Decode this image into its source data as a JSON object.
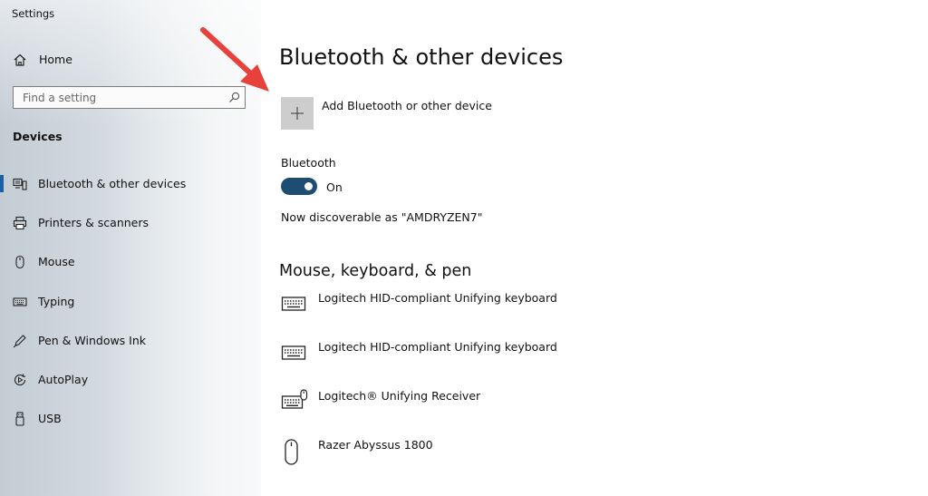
{
  "app_title": "Settings",
  "sidebar": {
    "home_label": "Home",
    "search_placeholder": "Find a setting",
    "section_label": "Devices",
    "items": [
      {
        "label": "Bluetooth & other devices",
        "icon": "bluetooth-devices-icon",
        "active": true
      },
      {
        "label": "Printers & scanners",
        "icon": "printer-icon"
      },
      {
        "label": "Mouse",
        "icon": "mouse-icon"
      },
      {
        "label": "Typing",
        "icon": "keyboard-icon"
      },
      {
        "label": "Pen & Windows Ink",
        "icon": "pen-icon"
      },
      {
        "label": "AutoPlay",
        "icon": "autoplay-icon"
      },
      {
        "label": "USB",
        "icon": "usb-icon"
      }
    ]
  },
  "main": {
    "title": "Bluetooth & other devices",
    "add_device_label": "Add Bluetooth or other device",
    "bluetooth_label": "Bluetooth",
    "bluetooth_state": "On",
    "discoverable_text": "Now discoverable as \"AMDRYZEN7\"",
    "section_title": "Mouse, keyboard, & pen",
    "devices": [
      {
        "name": "Logitech HID-compliant Unifying keyboard",
        "icon": "keyboard-icon"
      },
      {
        "name": "Logitech HID-compliant Unifying keyboard",
        "icon": "keyboard-icon"
      },
      {
        "name": "Logitech® Unifying Receiver",
        "icon": "keyboard-mouse-icon"
      },
      {
        "name": "Razer Abyssus 1800",
        "icon": "mouse-icon"
      }
    ]
  },
  "colors": {
    "accent": "#1a5fa8",
    "toggle_on": "#1e4d72",
    "annotation_arrow": "#e8403a"
  }
}
